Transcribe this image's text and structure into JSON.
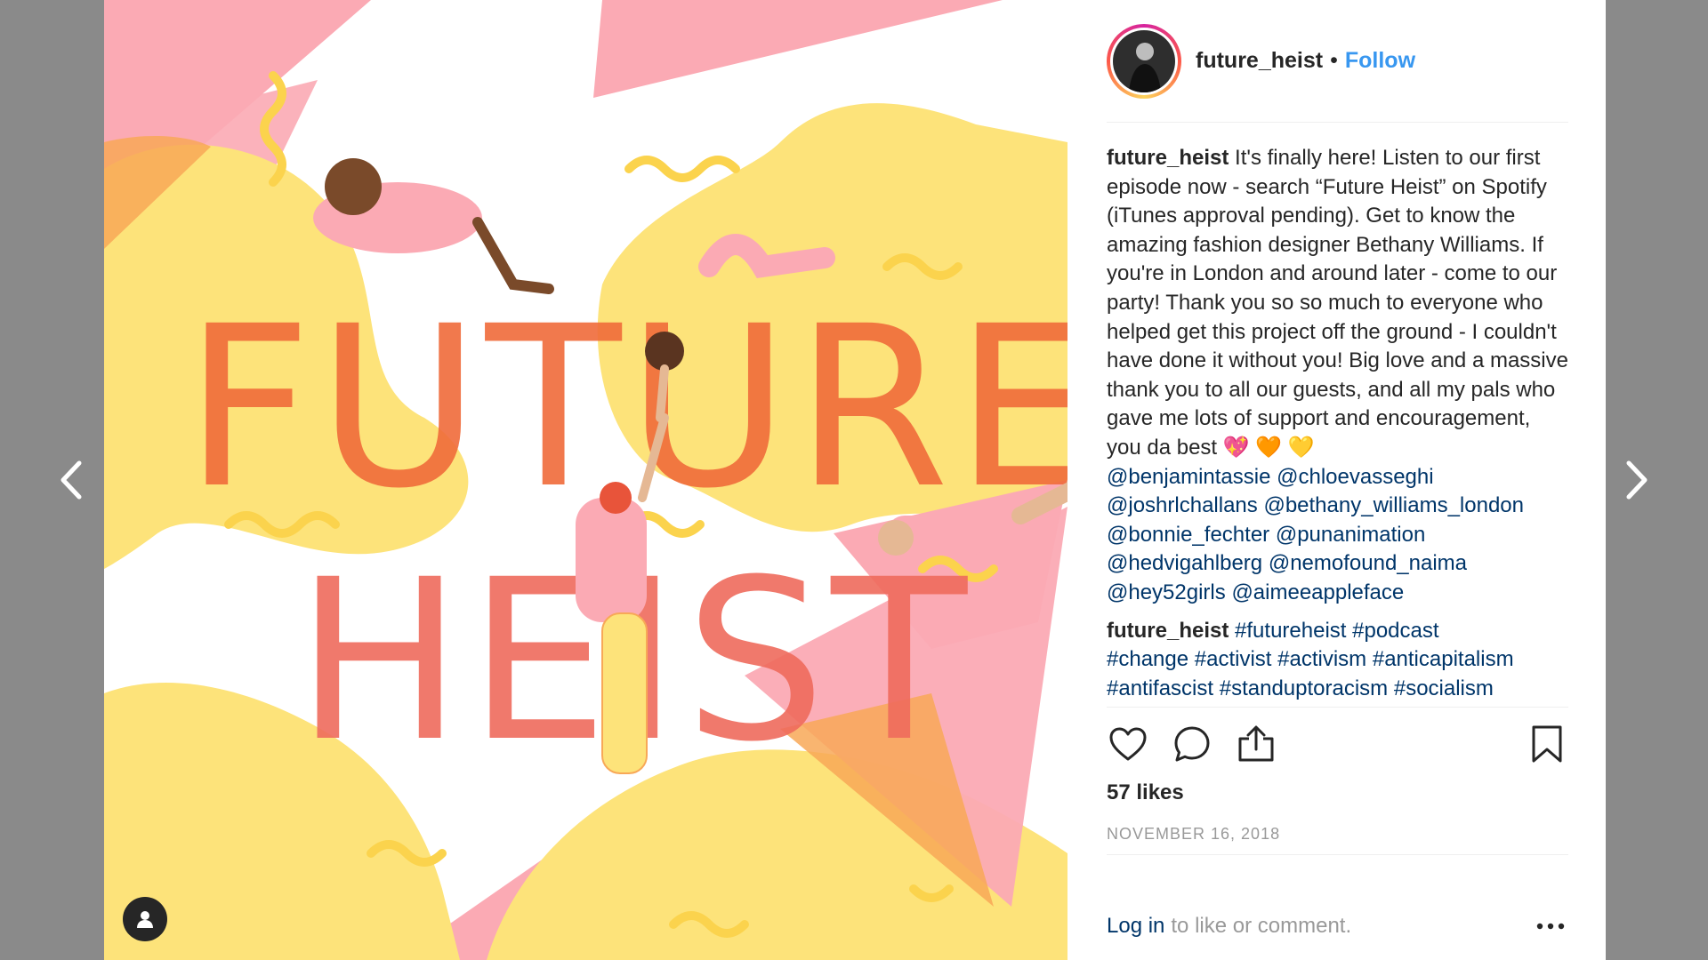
{
  "post": {
    "username": "future_heist",
    "separator": "•",
    "follow_label": "Follow",
    "caption": {
      "username": "future_heist",
      "text": "It's finally here! Listen to our first episode now - search “Future Heist” on Spotify (iTunes approval pending). Get to know the amazing fashion designer Bethany Williams. If you're in London and around later - come to our party! Thank you so so much to everyone who helped get this project off the ground - I couldn't have done it without you! Big love and a massive thank you to all our guests, and all my pals who gave me lots of support and encouragement, you da best 💖 🧡 💛",
      "mentions": [
        "@benjamintassie",
        "@chloevasseghi",
        "@joshrlchallans",
        "@bethany_williams_london",
        "@bonnie_fechter",
        "@punanimation",
        "@hedvigahlberg",
        "@nemofound_naima",
        "@hey52girls",
        "@aimeeappleface"
      ]
    },
    "comment": {
      "username": "future_heist",
      "hashtags": [
        "#futureheist",
        "#podcast",
        "#change",
        "#activist",
        "#activism",
        "#anticapitalism",
        "#antifascist",
        "#standuptoracism",
        "#socialism"
      ]
    },
    "likes": "57 likes",
    "date": "NOVEMBER 16, 2018",
    "login_link": "Log in",
    "login_rest": "to like or comment.",
    "image_text": {
      "line1": "FUTURE",
      "line2": "HEIST"
    }
  },
  "icons": {
    "prev": "chevron-left-icon",
    "next": "chevron-right-icon",
    "like": "heart-icon",
    "comment": "comment-icon",
    "share": "share-icon",
    "save": "bookmark-icon",
    "more": "more-dots-icon",
    "user_tag": "user-tag-icon"
  },
  "colors": {
    "follow": "#3897f0",
    "link": "#003569",
    "muted": "#999999",
    "title_orange": "#ef6a3a",
    "yellow": "#fde37a",
    "pink": "#fbaab4"
  }
}
